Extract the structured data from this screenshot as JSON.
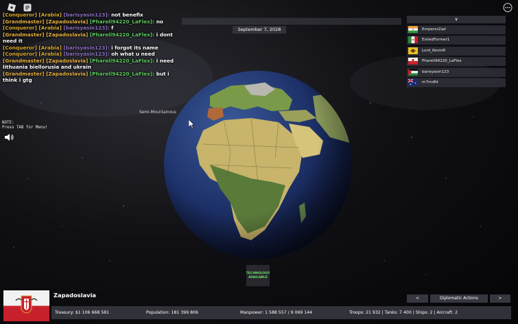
{
  "date": "September 7, 2028",
  "terrain_label": "Semi-Mountainous",
  "note": {
    "line1": "NOTE:",
    "line2": "Press TAB for Menu!"
  },
  "chat": [
    {
      "rank": "[Conqueror]",
      "country": "[Arabia]",
      "name": "[barisyasin123]:",
      "msg": "not benefix",
      "rank_color": "#d8a830",
      "country_color": "#d8a830",
      "name_color": "#8c6fbf"
    },
    {
      "rank": "[Grandmaster]",
      "country": "[Zapadoslavia]",
      "name": "[Pharell94220_LaFlex]:",
      "msg": "no",
      "rank_color": "#e8b040",
      "country_color": "#e8b040",
      "name_color": "#5ec85e"
    },
    {
      "rank": "[Conqueror]",
      "country": "[Arabia]",
      "name": "[barisyasin123]:",
      "msg": "f",
      "rank_color": "#d8a830",
      "country_color": "#d8a830",
      "name_color": "#8c6fbf"
    },
    {
      "rank": "[Grandmaster]",
      "country": "[Zapadoslavia]",
      "name": "[Pharell94220_LaFlex]:",
      "msg": "i dont need it",
      "rank_color": "#e8b040",
      "country_color": "#e8b040",
      "name_color": "#5ec85e"
    },
    {
      "rank": "[Conqueror]",
      "country": "[Arabia]",
      "name": "[barisyasin123]:",
      "msg": "i forgot its name",
      "rank_color": "#d8a830",
      "country_color": "#d8a830",
      "name_color": "#8c6fbf"
    },
    {
      "rank": "[Conqueror]",
      "country": "[Arabia]",
      "name": "[barisyasin123]:",
      "msg": "oh what u need",
      "rank_color": "#d8a830",
      "country_color": "#d8a830",
      "name_color": "#8c6fbf"
    },
    {
      "rank": "[Grandmaster]",
      "country": "[Zapadoslavia]",
      "name": "[Pharell94220_LaFlex]:",
      "msg": "i need lithuania biellorusia and ukrain",
      "rank_color": "#e8b040",
      "country_color": "#e8b040",
      "name_color": "#5ec85e"
    },
    {
      "rank": "[Grandmaster]",
      "country": "[Zapadoslavia]",
      "name": "[Pharell94220_LaFlex]:",
      "msg": "but i think i gtg",
      "rank_color": "#e8b040",
      "country_color": "#e8b040",
      "name_color": "#5ec85e"
    }
  ],
  "players_collapse": "∨",
  "players": [
    {
      "name": "EmperorZad",
      "flag": "india"
    },
    {
      "name": "ExiledFormer1",
      "flag": "mexico"
    },
    {
      "name": "Lord_KevinR",
      "flag": "yellow"
    },
    {
      "name": "Pharell94220_LaFlex",
      "flag": "zapadoslavia"
    },
    {
      "name": "barisyasin123",
      "flag": "arabia"
    },
    {
      "name": "m7mdfd",
      "flag": "australia"
    }
  ],
  "tech_button": {
    "line1": "TECHNOLOGY",
    "line2": "AVAILABLE"
  },
  "country": {
    "name": "Zapadoslavia"
  },
  "diplomacy": {
    "prev": "<",
    "label": "Diplomatic Actions",
    "next": ">"
  },
  "stats": {
    "treasury": "Treasury:  $1 106 668 581",
    "population": "Population: 181 399 806",
    "manpower": "Manpower:  1 588 557  /  9 069 144",
    "military": "Troops: 21 932  |  Tanks: 7 400  |  Ships: 2  |  Aircraft: 2"
  },
  "colors": {
    "tech_text": "#6be26b",
    "panel": "#3c3c46"
  }
}
